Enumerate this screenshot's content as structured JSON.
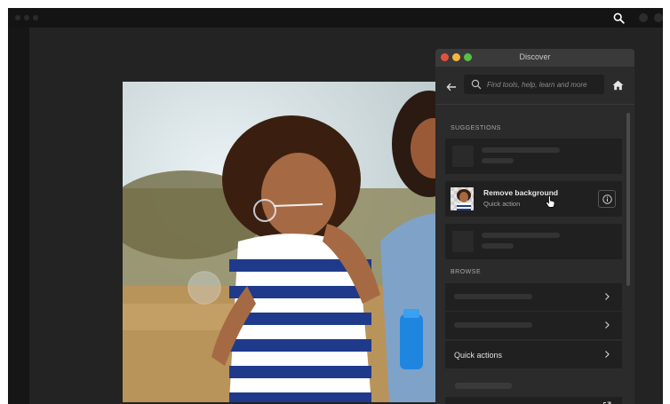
{
  "discover_panel": {
    "title": "Discover",
    "search_placeholder": "Find tools, help, learn and more",
    "suggestions_label": "SUGGESTIONS",
    "browse_label": "BROWSE",
    "remove_background": {
      "title": "Remove background",
      "subtitle": "Quick action"
    },
    "quick_actions_label": "Quick actions"
  },
  "colors": {
    "app_background": "#1b1b1b",
    "panel_background": "#2b2b2b",
    "card_background": "#202020",
    "close_dot": "#e0533f",
    "minimize_dot": "#f3b63f",
    "maximize_dot": "#55c140"
  }
}
